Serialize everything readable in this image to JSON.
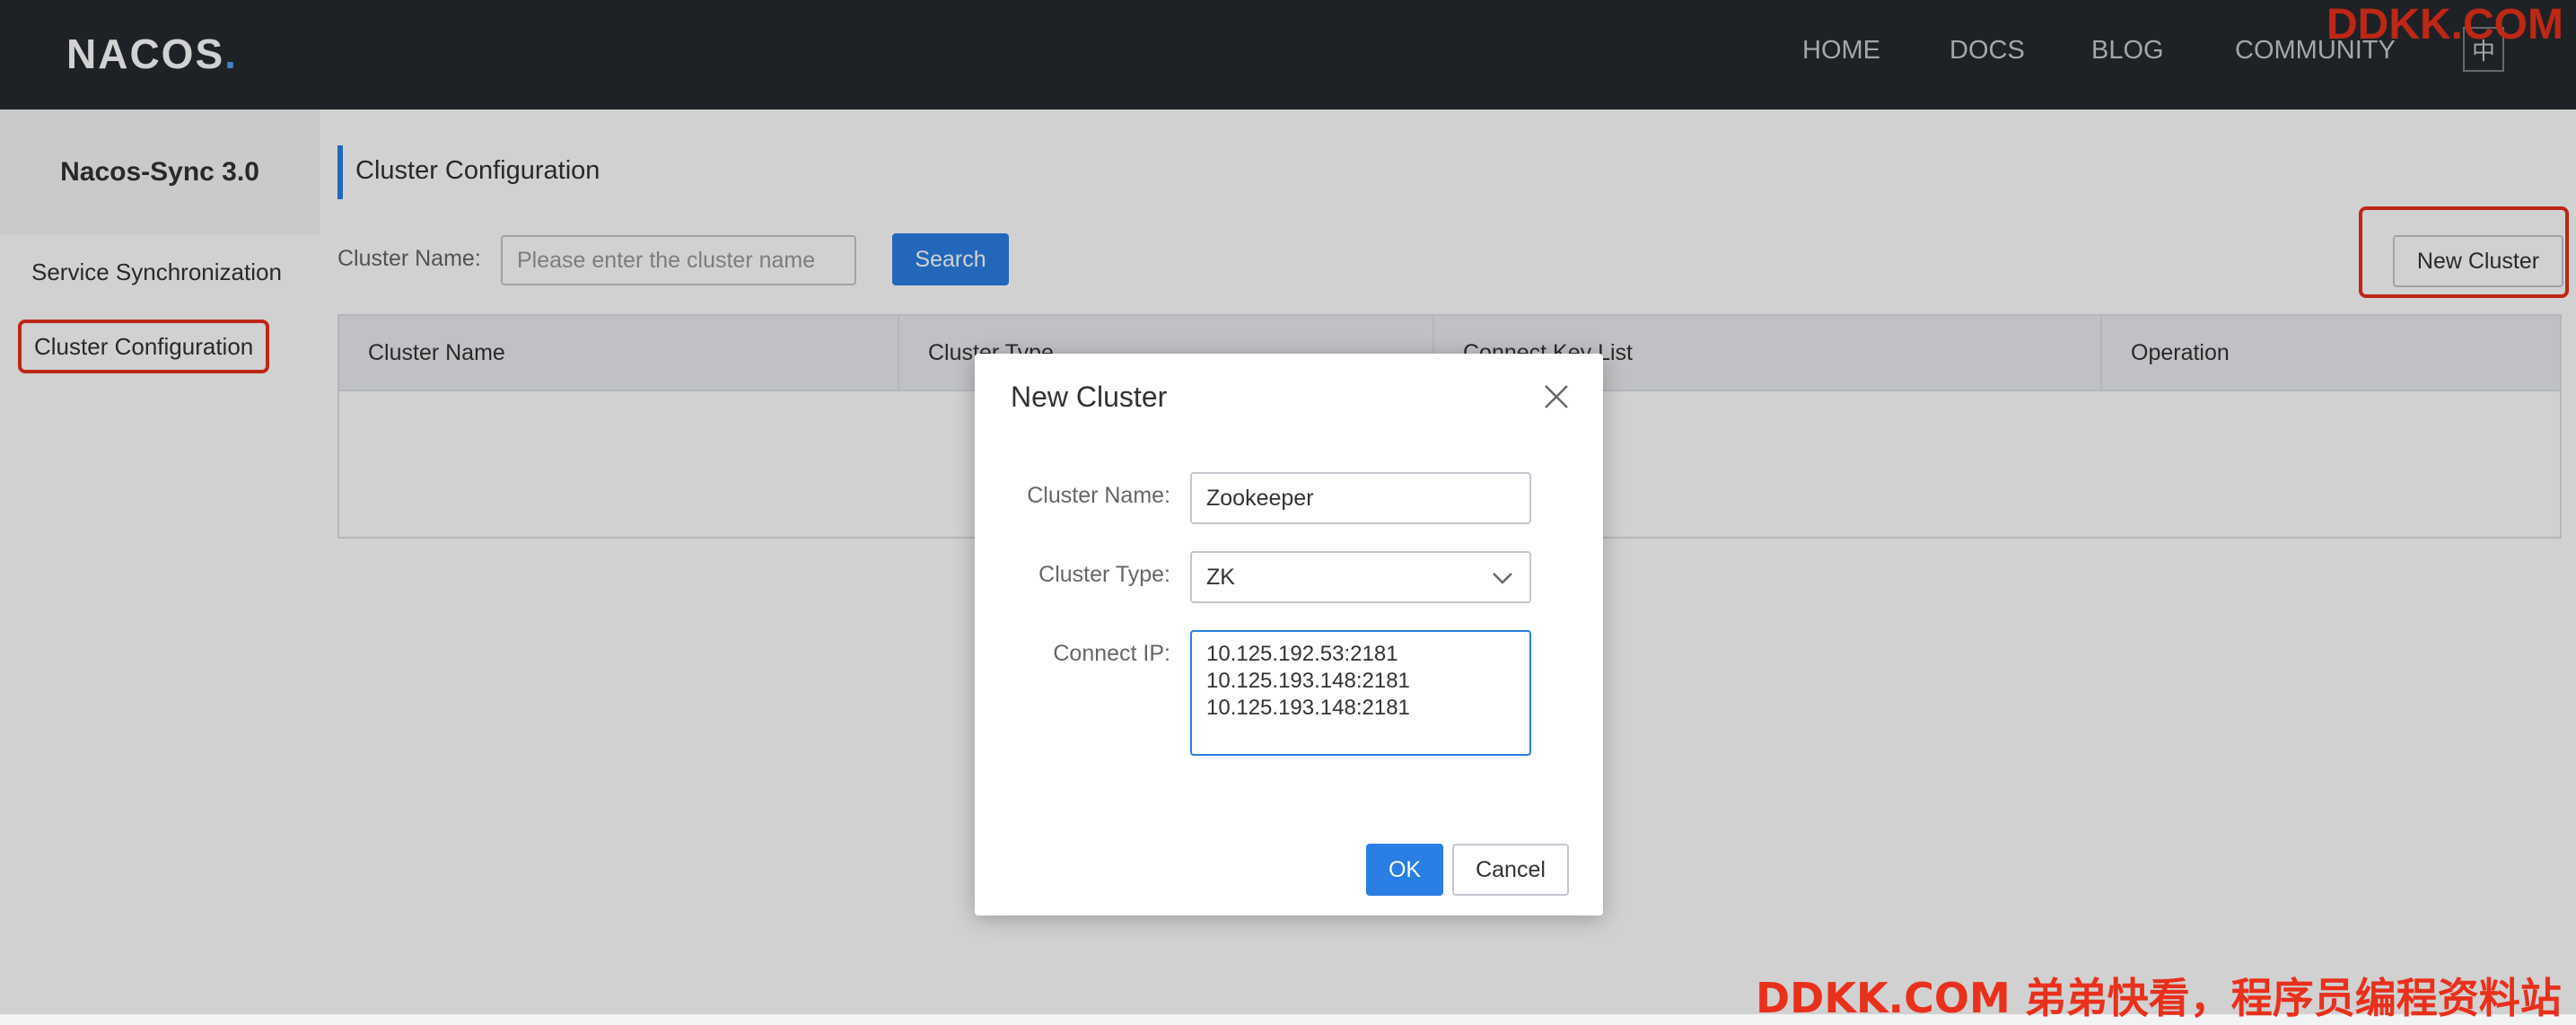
{
  "header": {
    "logo": "NACOS",
    "logo_dot": ".",
    "nav": [
      "HOME",
      "DOCS",
      "BLOG",
      "COMMUNITY"
    ],
    "lang_button": "中",
    "watermark": "DDKK.COM"
  },
  "sidebar": {
    "title": "Nacos-Sync 3.0",
    "items": [
      {
        "label": "Service Synchronization"
      },
      {
        "label": "Cluster Configuration"
      }
    ]
  },
  "main": {
    "page_title": "Cluster Configuration",
    "filter_label": "Cluster Name:",
    "filter_placeholder": "Please enter the cluster name",
    "search_button": "Search",
    "new_cluster_button": "New Cluster",
    "table_headers": [
      "Cluster Name",
      "Cluster Type",
      "Connect Key List",
      "Operation"
    ]
  },
  "dialog": {
    "title": "New Cluster",
    "cluster_name_label": "Cluster Name:",
    "cluster_name_value": "Zookeeper",
    "cluster_type_label": "Cluster Type:",
    "cluster_type_value": "ZK",
    "connect_ip_label": "Connect IP:",
    "connect_ip_value": "10.125.192.53:2181\n10.125.193.148:2181\n10.125.193.148:2181",
    "ok_button": "OK",
    "cancel_button": "Cancel"
  },
  "watermark_bottom": "DDKK.COM 弟弟快看，程序员编程资料站",
  "colors": {
    "topbar": "#252a2f",
    "primary": "#2a7ee3",
    "highlight": "#e8301c"
  }
}
